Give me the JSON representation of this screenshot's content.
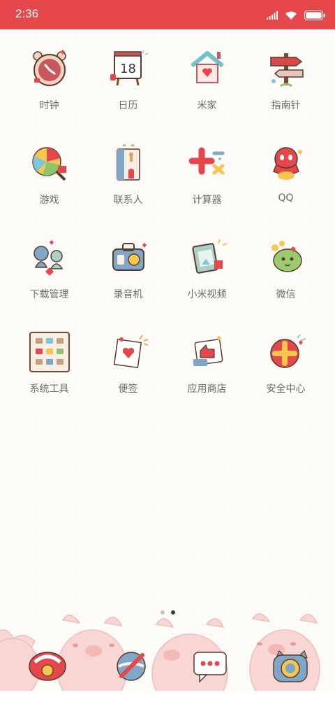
{
  "status_bar": {
    "time": "2:36",
    "background_color": "#e5474a",
    "icons": [
      "signal-icon",
      "wifi-icon",
      "battery-icon"
    ]
  },
  "apps": [
    {
      "label": "时钟",
      "icon": "clock-icon"
    },
    {
      "label": "日历",
      "icon": "calendar-icon",
      "badge": "18"
    },
    {
      "label": "米家",
      "icon": "mijia-house-icon"
    },
    {
      "label": "指南针",
      "icon": "signpost-compass-icon"
    },
    {
      "label": "游戏",
      "icon": "lollipop-games-icon"
    },
    {
      "label": "联系人",
      "icon": "contacts-book-icon"
    },
    {
      "label": "计算器",
      "icon": "calculator-icon"
    },
    {
      "label": "QQ",
      "icon": "qq-penguin-icon"
    },
    {
      "label": "下载管理",
      "icon": "download-manager-icon"
    },
    {
      "label": "录音机",
      "icon": "recorder-icon"
    },
    {
      "label": "小米视频",
      "icon": "video-icon"
    },
    {
      "label": "微信",
      "icon": "wechat-icon"
    },
    {
      "label": "系统工具",
      "icon": "system-tools-folder-icon"
    },
    {
      "label": "便签",
      "icon": "notes-icon"
    },
    {
      "label": "应用商店",
      "icon": "app-store-icon"
    },
    {
      "label": "安全中心",
      "icon": "security-center-icon"
    }
  ],
  "page_indicator": {
    "pages": 2,
    "current": 2
  },
  "dock": {
    "apps": [
      {
        "icon": "phone-icon"
      },
      {
        "icon": "browser-icon"
      },
      {
        "icon": "messages-icon"
      },
      {
        "icon": "camera-icon"
      }
    ]
  }
}
